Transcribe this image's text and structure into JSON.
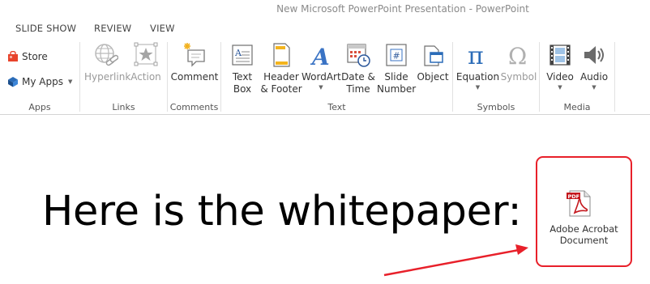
{
  "window": {
    "title": "New Microsoft PowerPoint Presentation - PowerPoint"
  },
  "tabs": [
    "SLIDE SHOW",
    "REVIEW",
    "VIEW"
  ],
  "ribbon": {
    "apps": {
      "store": "Store",
      "my_apps": "My Apps",
      "label": "Apps"
    },
    "links": {
      "hyperlink": "Hyperlink",
      "action": "Action",
      "label": "Links"
    },
    "comments": {
      "comment": "Comment",
      "label": "Comments"
    },
    "text": {
      "text_box_1": "Text",
      "text_box_2": "Box",
      "header_1": "Header",
      "header_2": "& Footer",
      "wordart": "WordArt",
      "datetime_1": "Date &",
      "datetime_2": "Time",
      "slide_number_1": "Slide",
      "slide_number_2": "Number",
      "object": "Object",
      "label": "Text"
    },
    "symbols": {
      "equation": "Equation",
      "symbol": "Symbol",
      "label": "Symbols"
    },
    "media": {
      "video": "Video",
      "audio": "Audio",
      "label": "Media"
    }
  },
  "slide": {
    "text": "Here is the whitepaper:",
    "embedded_object_1": "Adobe Acrobat",
    "embedded_object_2": "Document",
    "pdf_badge": "PDF"
  },
  "colors": {
    "highlight_border": "#e8202a",
    "arrow": "#e8202a",
    "accent_blue": "#2b579a"
  }
}
